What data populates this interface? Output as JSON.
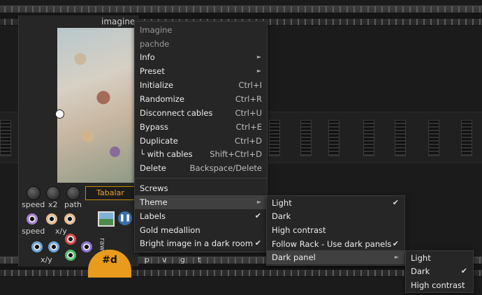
{
  "module": {
    "title": "imagine",
    "name_display": "Tabalar",
    "labels": {
      "speed1": "speed",
      "x2": "x2",
      "path": "path",
      "speed2": "speed",
      "xy1": "x/y",
      "xy2": "x/y",
      "raw": "raw",
      "p": "p",
      "v": "v",
      "g": "g",
      "t": "t"
    },
    "logo_text": "#d",
    "jack_colors": [
      "#a77fd4",
      "#e8b98a",
      "#e8b98a",
      "#6aa6d9",
      "#6aa6d9",
      "#e0474c",
      "#4fbf6a",
      "#8b6fd1"
    ]
  },
  "context_menu": {
    "header": [
      "Imagine",
      "pachde"
    ],
    "items": [
      {
        "label": "Info",
        "arrow": "►"
      },
      {
        "label": "Preset",
        "arrow": "►"
      },
      {
        "label": "Initialize",
        "shortcut": "Ctrl+I"
      },
      {
        "label": "Randomize",
        "shortcut": "Ctrl+R"
      },
      {
        "label": "Disconnect cables",
        "shortcut": "Ctrl+U"
      },
      {
        "label": "Bypass",
        "shortcut": "Ctrl+E"
      },
      {
        "label": "Duplicate",
        "shortcut": "Ctrl+D"
      },
      {
        "label": "└ with cables",
        "shortcut": "Shift+Ctrl+D"
      },
      {
        "label": "Delete",
        "shortcut": "Backspace/Delete"
      }
    ],
    "items2": [
      {
        "label": "Screws"
      },
      {
        "label": "Theme",
        "arrow": "►"
      },
      {
        "label": "Labels",
        "check": "✔"
      },
      {
        "label": "Gold medallion"
      },
      {
        "label": "Bright image in a dark room",
        "check": "✔"
      }
    ]
  },
  "theme_menu": {
    "items": [
      {
        "label": "Light",
        "check": "✔"
      },
      {
        "label": "Dark"
      },
      {
        "label": "High contrast"
      },
      {
        "label": "Follow Rack - Use dark panels",
        "check": "✔"
      },
      {
        "label": "Dark panel",
        "arrow": "►"
      }
    ]
  },
  "dark_panel_menu": {
    "items": [
      {
        "label": "Light"
      },
      {
        "label": "Dark",
        "check": "✔"
      },
      {
        "label": "High contrast"
      }
    ]
  }
}
